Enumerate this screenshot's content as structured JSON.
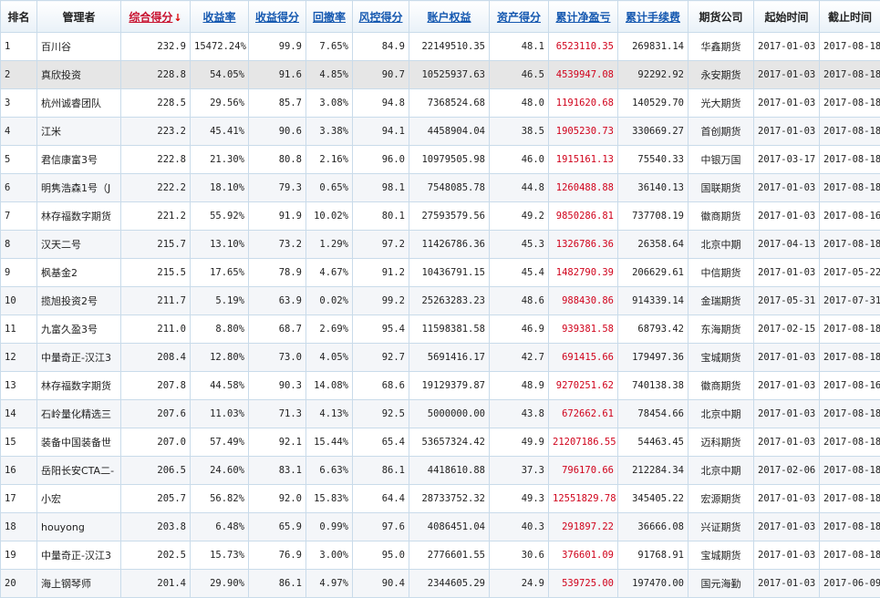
{
  "colors": {
    "profit": "#d0021b",
    "header_link": "#1558b0",
    "sorted_header": "#c8102e",
    "border": "#c9dbea"
  },
  "sort_arrow_icon": "arrow-down-icon",
  "columns": {
    "rank": "排名",
    "manager": "管理者",
    "composite_score": "综合得分",
    "return_rate": "收益率",
    "return_score": "收益得分",
    "drawdown": "回撤率",
    "risk_score": "风控得分",
    "equity": "账户权益",
    "asset_score": "资产得分",
    "net_profit": "累计净盈亏",
    "fees": "累计手续费",
    "company": "期货公司",
    "start_date": "起始时间",
    "end_date": "截止时间"
  },
  "sort_indicator": "↓",
  "rows": [
    {
      "rank": "1",
      "manager": "百川谷",
      "composite_score": "232.9",
      "return_rate": "15472.24%",
      "return_score": "99.9",
      "drawdown": "7.65%",
      "risk_score": "84.9",
      "equity": "22149510.35",
      "asset_score": "48.1",
      "net_profit": "6523110.35",
      "fees": "269831.14",
      "company": "华鑫期货",
      "start_date": "2017-01-03",
      "end_date": "2017-08-18"
    },
    {
      "rank": "2",
      "manager": "真欣投资",
      "composite_score": "228.8",
      "return_rate": "54.05%",
      "return_score": "91.6",
      "drawdown": "4.85%",
      "risk_score": "90.7",
      "equity": "10525937.63",
      "asset_score": "46.5",
      "net_profit": "4539947.08",
      "fees": "92292.92",
      "company": "永安期货",
      "start_date": "2017-01-03",
      "end_date": "2017-08-18"
    },
    {
      "rank": "3",
      "manager": "杭州诚睿团队",
      "composite_score": "228.5",
      "return_rate": "29.56%",
      "return_score": "85.7",
      "drawdown": "3.08%",
      "risk_score": "94.8",
      "equity": "7368524.68",
      "asset_score": "48.0",
      "net_profit": "1191620.68",
      "fees": "140529.70",
      "company": "光大期货",
      "start_date": "2017-01-03",
      "end_date": "2017-08-18"
    },
    {
      "rank": "4",
      "manager": "江米",
      "composite_score": "223.2",
      "return_rate": "45.41%",
      "return_score": "90.6",
      "drawdown": "3.38%",
      "risk_score": "94.1",
      "equity": "4458904.04",
      "asset_score": "38.5",
      "net_profit": "1905230.73",
      "fees": "330669.27",
      "company": "首创期货",
      "start_date": "2017-01-03",
      "end_date": "2017-08-18"
    },
    {
      "rank": "5",
      "manager": "君信康富3号",
      "composite_score": "222.8",
      "return_rate": "21.30%",
      "return_score": "80.8",
      "drawdown": "2.16%",
      "risk_score": "96.0",
      "equity": "10979505.98",
      "asset_score": "46.0",
      "net_profit": "1915161.13",
      "fees": "75540.33",
      "company": "中银万国",
      "start_date": "2017-03-17",
      "end_date": "2017-08-18"
    },
    {
      "rank": "6",
      "manager": "明隽浩森1号（J",
      "composite_score": "222.2",
      "return_rate": "18.10%",
      "return_score": "79.3",
      "drawdown": "0.65%",
      "risk_score": "98.1",
      "equity": "7548085.78",
      "asset_score": "44.8",
      "net_profit": "1260488.88",
      "fees": "36140.13",
      "company": "国联期货",
      "start_date": "2017-01-03",
      "end_date": "2017-08-18"
    },
    {
      "rank": "7",
      "manager": "林存福数字期货",
      "composite_score": "221.2",
      "return_rate": "55.92%",
      "return_score": "91.9",
      "drawdown": "10.02%",
      "risk_score": "80.1",
      "equity": "27593579.56",
      "asset_score": "49.2",
      "net_profit": "9850286.81",
      "fees": "737708.19",
      "company": "徽商期货",
      "start_date": "2017-01-03",
      "end_date": "2017-08-16"
    },
    {
      "rank": "8",
      "manager": "汉天二号",
      "composite_score": "215.7",
      "return_rate": "13.10%",
      "return_score": "73.2",
      "drawdown": "1.29%",
      "risk_score": "97.2",
      "equity": "11426786.36",
      "asset_score": "45.3",
      "net_profit": "1326786.36",
      "fees": "26358.64",
      "company": "北京中期",
      "start_date": "2017-04-13",
      "end_date": "2017-08-18"
    },
    {
      "rank": "9",
      "manager": "枫基金2",
      "composite_score": "215.5",
      "return_rate": "17.65%",
      "return_score": "78.9",
      "drawdown": "4.67%",
      "risk_score": "91.2",
      "equity": "10436791.15",
      "asset_score": "45.4",
      "net_profit": "1482790.39",
      "fees": "206629.61",
      "company": "中信期货",
      "start_date": "2017-01-03",
      "end_date": "2017-05-22"
    },
    {
      "rank": "10",
      "manager": "揽旭投资2号",
      "composite_score": "211.7",
      "return_rate": "5.19%",
      "return_score": "63.9",
      "drawdown": "0.02%",
      "risk_score": "99.2",
      "equity": "25263283.23",
      "asset_score": "48.6",
      "net_profit": "988430.86",
      "fees": "914339.14",
      "company": "金瑞期货",
      "start_date": "2017-05-31",
      "end_date": "2017-07-31"
    },
    {
      "rank": "11",
      "manager": "九富久盈3号",
      "composite_score": "211.0",
      "return_rate": "8.80%",
      "return_score": "68.7",
      "drawdown": "2.69%",
      "risk_score": "95.4",
      "equity": "11598381.58",
      "asset_score": "46.9",
      "net_profit": "939381.58",
      "fees": "68793.42",
      "company": "东海期货",
      "start_date": "2017-02-15",
      "end_date": "2017-08-18"
    },
    {
      "rank": "12",
      "manager": "中量奇正-汉江3",
      "composite_score": "208.4",
      "return_rate": "12.80%",
      "return_score": "73.0",
      "drawdown": "4.05%",
      "risk_score": "92.7",
      "equity": "5691416.17",
      "asset_score": "42.7",
      "net_profit": "691415.66",
      "fees": "179497.36",
      "company": "宝城期货",
      "start_date": "2017-01-03",
      "end_date": "2017-08-18"
    },
    {
      "rank": "13",
      "manager": "林存福数字期货",
      "composite_score": "207.8",
      "return_rate": "44.58%",
      "return_score": "90.3",
      "drawdown": "14.08%",
      "risk_score": "68.6",
      "equity": "19129379.87",
      "asset_score": "48.9",
      "net_profit": "9270251.62",
      "fees": "740138.38",
      "company": "徽商期货",
      "start_date": "2017-01-03",
      "end_date": "2017-08-16"
    },
    {
      "rank": "14",
      "manager": "石岭量化精选三",
      "composite_score": "207.6",
      "return_rate": "11.03%",
      "return_score": "71.3",
      "drawdown": "4.13%",
      "risk_score": "92.5",
      "equity": "5000000.00",
      "asset_score": "43.8",
      "net_profit": "672662.61",
      "fees": "78454.66",
      "company": "北京中期",
      "start_date": "2017-01-03",
      "end_date": "2017-08-18"
    },
    {
      "rank": "15",
      "manager": "装备中国装备世",
      "composite_score": "207.0",
      "return_rate": "57.49%",
      "return_score": "92.1",
      "drawdown": "15.44%",
      "risk_score": "65.4",
      "equity": "53657324.42",
      "asset_score": "49.9",
      "net_profit": "21207186.55",
      "fees": "54463.45",
      "company": "迈科期货",
      "start_date": "2017-01-03",
      "end_date": "2017-08-18"
    },
    {
      "rank": "16",
      "manager": "岳阳长安CTA二-",
      "composite_score": "206.5",
      "return_rate": "24.60%",
      "return_score": "83.1",
      "drawdown": "6.63%",
      "risk_score": "86.1",
      "equity": "4418610.88",
      "asset_score": "37.3",
      "net_profit": "796170.66",
      "fees": "212284.34",
      "company": "北京中期",
      "start_date": "2017-02-06",
      "end_date": "2017-08-18"
    },
    {
      "rank": "17",
      "manager": "小宏",
      "composite_score": "205.7",
      "return_rate": "56.82%",
      "return_score": "92.0",
      "drawdown": "15.83%",
      "risk_score": "64.4",
      "equity": "28733752.32",
      "asset_score": "49.3",
      "net_profit": "12551829.78",
      "fees": "345405.22",
      "company": "宏源期货",
      "start_date": "2017-01-03",
      "end_date": "2017-08-18"
    },
    {
      "rank": "18",
      "manager": "houyong",
      "composite_score": "203.8",
      "return_rate": "6.48%",
      "return_score": "65.9",
      "drawdown": "0.99%",
      "risk_score": "97.6",
      "equity": "4086451.04",
      "asset_score": "40.3",
      "net_profit": "291897.22",
      "fees": "36666.08",
      "company": "兴证期货",
      "start_date": "2017-01-03",
      "end_date": "2017-08-18"
    },
    {
      "rank": "19",
      "manager": "中量奇正-汉江3",
      "composite_score": "202.5",
      "return_rate": "15.73%",
      "return_score": "76.9",
      "drawdown": "3.00%",
      "risk_score": "95.0",
      "equity": "2776601.55",
      "asset_score": "30.6",
      "net_profit": "376601.09",
      "fees": "91768.91",
      "company": "宝城期货",
      "start_date": "2017-01-03",
      "end_date": "2017-08-18"
    },
    {
      "rank": "20",
      "manager": "海上钢琴师",
      "composite_score": "201.4",
      "return_rate": "29.90%",
      "return_score": "86.1",
      "drawdown": "4.97%",
      "risk_score": "90.4",
      "equity": "2344605.29",
      "asset_score": "24.9",
      "net_profit": "539725.00",
      "fees": "197470.00",
      "company": "国元海勤",
      "start_date": "2017-01-03",
      "end_date": "2017-06-09"
    }
  ]
}
